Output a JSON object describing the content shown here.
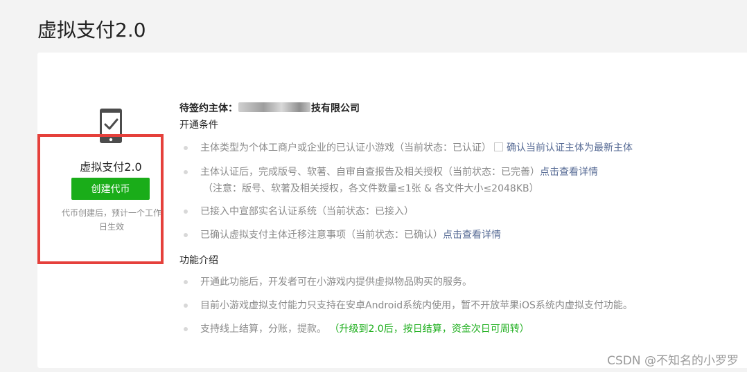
{
  "page": {
    "title": "虚拟支付2.0"
  },
  "product": {
    "name": "虚拟支付2.0",
    "create_button": "创建代币",
    "note": "代币创建后，预计一个工作日生效"
  },
  "entity": {
    "label": "待签约主体：",
    "name_suffix": "技有限公司"
  },
  "conditions": {
    "heading": "开通条件",
    "items": [
      {
        "text": "主体类型为个体工商户或企业的已认证小游戏（当前状态：已认证）",
        "link": "确认当前认证主体为最新主体"
      },
      {
        "text": "主体认证后，完成版号、软著、自审自查报告及相关授权（当前状态：已完善）",
        "link": "点击查看详情",
        "note": "（注意：版号、软著及相关授权，各文件数量≤1张 & 各文件大小≤2048KB）"
      },
      {
        "text": "已接入中宣部实名认证系统（当前状态：已接入）"
      },
      {
        "text": "已确认虚拟支付主体迁移注意事项（当前状态：已确认）",
        "link": "点击查看详情"
      }
    ]
  },
  "features": {
    "heading": "功能介绍",
    "items": [
      {
        "text": "开通此功能后，开发者可在小游戏内提供虚拟物品购买的服务。"
      },
      {
        "text": "目前小游戏虚拟支付能力只支持在安卓Android系统内使用，暂不开放苹果iOS系统内虚拟支付功能。"
      },
      {
        "text": "支持线上结算，分账，提款。",
        "highlight": "（升级到2.0后，按日结算，资金次日可周转）"
      }
    ]
  },
  "watermark": "CSDN @不知名的小罗罗",
  "colors": {
    "accent_green": "#1aad19",
    "link": "#576b95",
    "highlight_border": "#e5403b"
  },
  "icons": [
    "phone-check-icon"
  ]
}
